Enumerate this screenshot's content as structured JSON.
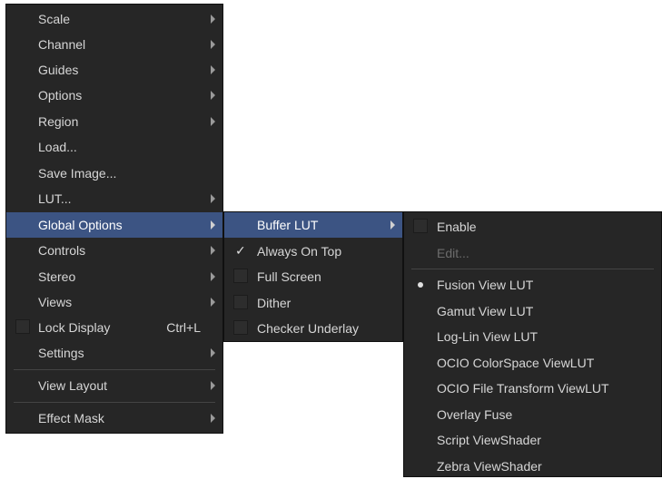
{
  "main_menu": {
    "items": [
      {
        "label": "Scale"
      },
      {
        "label": "Channel"
      },
      {
        "label": "Guides"
      },
      {
        "label": "Options"
      },
      {
        "label": "Region"
      },
      {
        "label": "Load..."
      },
      {
        "label": "Save Image..."
      },
      {
        "label": "LUT..."
      },
      {
        "label": "Global Options"
      },
      {
        "label": "Controls"
      },
      {
        "label": "Stereo"
      },
      {
        "label": "Views"
      },
      {
        "label": "Lock Display",
        "shortcut": "Ctrl+L"
      },
      {
        "label": "Settings"
      },
      {
        "label": "View Layout"
      },
      {
        "label": "Effect Mask"
      }
    ]
  },
  "global_options_menu": {
    "items": [
      {
        "label": "Buffer LUT"
      },
      {
        "label": "Always On Top",
        "check": "✓"
      },
      {
        "label": "Full Screen"
      },
      {
        "label": "Dither"
      },
      {
        "label": "Checker Underlay"
      }
    ]
  },
  "buffer_lut_menu": {
    "items": [
      {
        "label": "Enable"
      },
      {
        "label": "Edit..."
      },
      {
        "label": "Fusion View LUT"
      },
      {
        "label": "Gamut View LUT"
      },
      {
        "label": "Log-Lin View LUT"
      },
      {
        "label": "OCIO ColorSpace ViewLUT"
      },
      {
        "label": "OCIO File Transform ViewLUT"
      },
      {
        "label": "Overlay Fuse"
      },
      {
        "label": "Script ViewShader"
      },
      {
        "label": "Zebra ViewShader"
      }
    ]
  },
  "colors": {
    "menu_background": "#262626",
    "highlight": "#3c5483",
    "text": "#d6d6d6",
    "disabled_text": "#6c6c6c"
  }
}
